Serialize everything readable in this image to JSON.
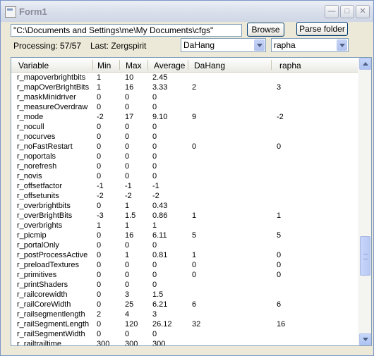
{
  "window": {
    "title": "Form1"
  },
  "toolbar": {
    "path_value": "\"C:\\Documents and Settings\\me\\My Documents\\cfgs\"",
    "browse_label": "Browse",
    "parse_label": "Parse folder"
  },
  "status": {
    "processing": "Processing: 57/57",
    "last": "Last: Zergspirit"
  },
  "selectors": {
    "player1": "DaHang",
    "player2": "rapha"
  },
  "grid": {
    "columns": [
      "Variable",
      "Min",
      "Max",
      "Average",
      "DaHang",
      "rapha"
    ],
    "rows": [
      [
        "r_mapoverbrightbits",
        "1",
        "10",
        "2.45",
        "",
        ""
      ],
      [
        "r_mapOverBrightBits",
        "1",
        "16",
        "3.33",
        "2",
        "3"
      ],
      [
        "r_maskMinidriver",
        "0",
        "0",
        "0",
        "",
        ""
      ],
      [
        "r_measureOverdraw",
        "0",
        "0",
        "0",
        "",
        ""
      ],
      [
        "r_mode",
        "-2",
        "17",
        "9.10",
        "9",
        "-2"
      ],
      [
        "r_nocull",
        "0",
        "0",
        "0",
        "",
        ""
      ],
      [
        "r_nocurves",
        "0",
        "0",
        "0",
        "",
        ""
      ],
      [
        "r_noFastRestart",
        "0",
        "0",
        "0",
        "0",
        "0"
      ],
      [
        "r_noportals",
        "0",
        "0",
        "0",
        "",
        ""
      ],
      [
        "r_norefresh",
        "0",
        "0",
        "0",
        "",
        ""
      ],
      [
        "r_novis",
        "0",
        "0",
        "0",
        "",
        ""
      ],
      [
        "r_offsetfactor",
        "-1",
        "-1",
        "-1",
        "",
        ""
      ],
      [
        "r_offsetunits",
        "-2",
        "-2",
        "-2",
        "",
        ""
      ],
      [
        "r_overbrightbits",
        "0",
        "1",
        "0.43",
        "",
        ""
      ],
      [
        "r_overBrightBits",
        "-3",
        "1.5",
        "0.86",
        "1",
        "1"
      ],
      [
        "r_overbrights",
        "1",
        "1",
        "1",
        "",
        ""
      ],
      [
        "r_picmip",
        "0",
        "16",
        "6.11",
        "5",
        "5"
      ],
      [
        "r_portalOnly",
        "0",
        "0",
        "0",
        "",
        ""
      ],
      [
        "r_postProcessActive",
        "0",
        "1",
        "0.81",
        "1",
        "0"
      ],
      [
        "r_preloadTextures",
        "0",
        "0",
        "0",
        "0",
        "0"
      ],
      [
        "r_primitives",
        "0",
        "0",
        "0",
        "0",
        "0"
      ],
      [
        "r_printShaders",
        "0",
        "0",
        "0",
        "",
        ""
      ],
      [
        "r_railcorewidth",
        "0",
        "3",
        "1.5",
        "",
        ""
      ],
      [
        "r_railCoreWidth",
        "0",
        "25",
        "6.21",
        "6",
        "6"
      ],
      [
        "r_railsegmentlength",
        "2",
        "4",
        "3",
        "",
        ""
      ],
      [
        "r_railSegmentLength",
        "0",
        "120",
        "26.12",
        "32",
        "16"
      ],
      [
        "r_railSegmentWidth",
        "0",
        "0",
        "0",
        "",
        ""
      ],
      [
        "r_railtrailtime",
        "300",
        "300",
        "300",
        "",
        ""
      ]
    ]
  }
}
